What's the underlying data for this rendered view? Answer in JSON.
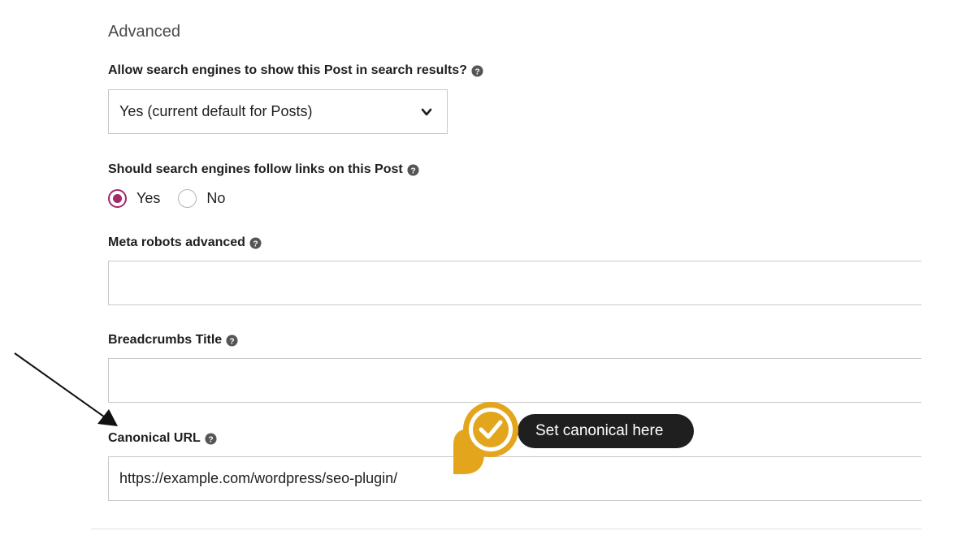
{
  "section": {
    "title": "Advanced"
  },
  "search_visibility": {
    "label": "Allow search engines to show this Post in search results?",
    "selected": "Yes (current default for Posts)"
  },
  "follow_links": {
    "label": "Should search engines follow links on this Post",
    "options": [
      "Yes",
      "No"
    ],
    "selected": "Yes"
  },
  "meta_robots": {
    "label": "Meta robots advanced",
    "value": ""
  },
  "breadcrumbs": {
    "label": "Breadcrumbs Title",
    "value": ""
  },
  "canonical": {
    "label": "Canonical URL",
    "value": "https://example.com/wordpress/seo-plugin/"
  },
  "callout": {
    "text": "Set canonical here"
  },
  "colors": {
    "radio_accent": "#a4286a",
    "badge_gold": "#e3a51c",
    "callout_bg": "#1f1f1f"
  },
  "icons": [
    "help-icon",
    "chevron-down-icon",
    "check-badge-icon",
    "arrow-annotation"
  ]
}
